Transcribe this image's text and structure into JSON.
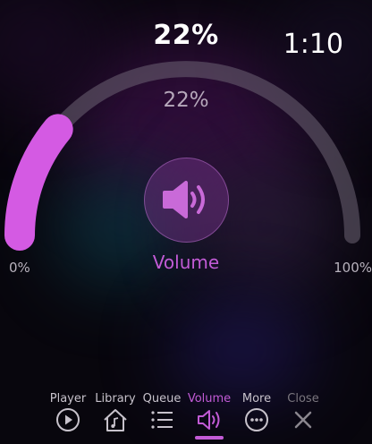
{
  "header": {
    "volume_percent_label": "22%",
    "clock": "1:10"
  },
  "volume_control": {
    "level": 0.22,
    "percent_label": "22%",
    "min_label": "0%",
    "max_label": "100%",
    "label": "Volume",
    "accent_color": "#d45ae3",
    "track_color": "#6e6474"
  },
  "tabs": [
    {
      "label": "Player",
      "icon": "play-circle-icon",
      "active": false
    },
    {
      "label": "Library",
      "icon": "home-music-icon",
      "active": false
    },
    {
      "label": "Queue",
      "icon": "list-icon",
      "active": false
    },
    {
      "label": "Volume",
      "icon": "speaker-icon",
      "active": true
    },
    {
      "label": "More",
      "icon": "more-circle-icon",
      "active": false
    },
    {
      "label": "Close",
      "icon": "close-icon",
      "active": false
    }
  ]
}
